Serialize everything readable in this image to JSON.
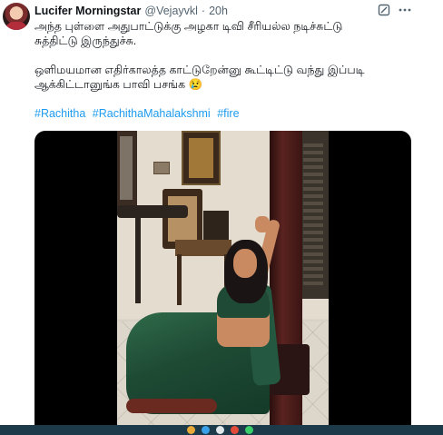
{
  "tweet": {
    "author_name": "Lucifer Morningstar",
    "handle": "@Vejayvkl",
    "separator": "·",
    "time": "20h",
    "text_lines": [
      "அந்த புள்ளை அதுபாட்டுக்கு அழகா டிவி சீரியல்ல நடிச்சுட்டு",
      "சுத்திட்டு இருந்துச்சு."
    ],
    "text_lines_2": [
      "ஒளிமயமான எதிர்காலத்த காட்டுறேன்னு கூட்டிட்டு வந்து இப்படி",
      "ஆக்கிட்டானுங்க பாவி பசங்க 😢"
    ],
    "hashtags": [
      "#Rachitha",
      "#RachithaMahalakshmi",
      "#fire"
    ]
  },
  "icons": {
    "grok": "grok-icon",
    "more": "more-options-icon"
  },
  "colors": {
    "link": "#1d9bf0",
    "secondary_text": "#536471",
    "media_bg": "#000000"
  }
}
